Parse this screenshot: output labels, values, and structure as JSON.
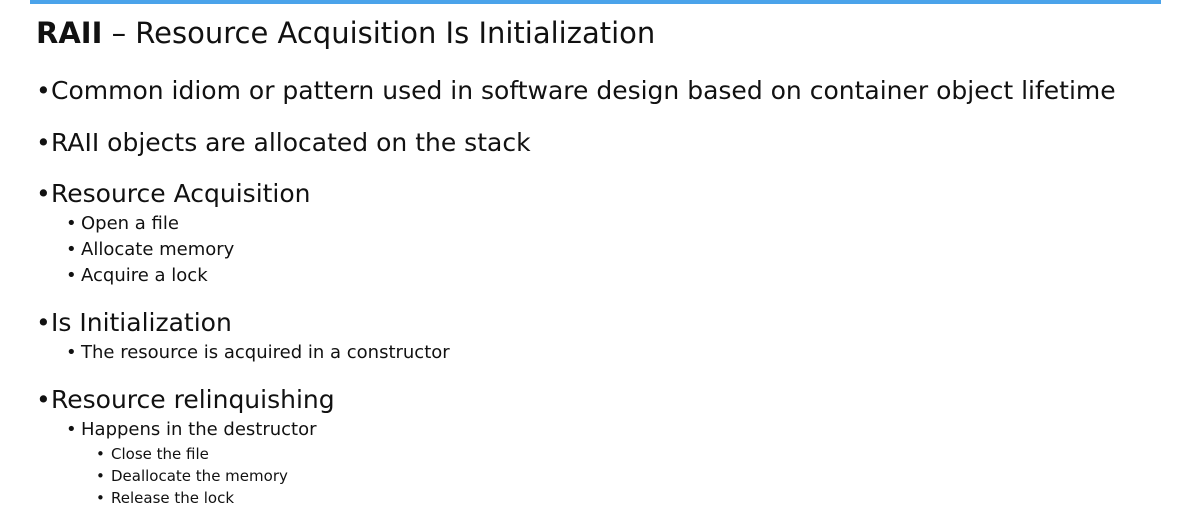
{
  "slide": {
    "title_bold": "RAII",
    "title_rest": " – Resource Acquisition Is Initialization",
    "accent_color": "#4aa3ea",
    "bullet_glyph": "•",
    "bullets": {
      "b1": "Common idiom or pattern used in software design based on container object lifetime",
      "b2": "RAII objects are allocated on the stack",
      "b3": "Resource Acquisition",
      "b3_1": "Open a file",
      "b3_2": "Allocate memory",
      "b3_3": "Acquire a lock",
      "b4": "Is Initialization",
      "b4_1": "The resource is acquired in a constructor",
      "b5": "Resource relinquishing",
      "b5_1": "Happens in the destructor",
      "b5_1_1": "Close the file",
      "b5_1_2": "Deallocate the memory",
      "b5_1_3": "Release the lock"
    }
  }
}
